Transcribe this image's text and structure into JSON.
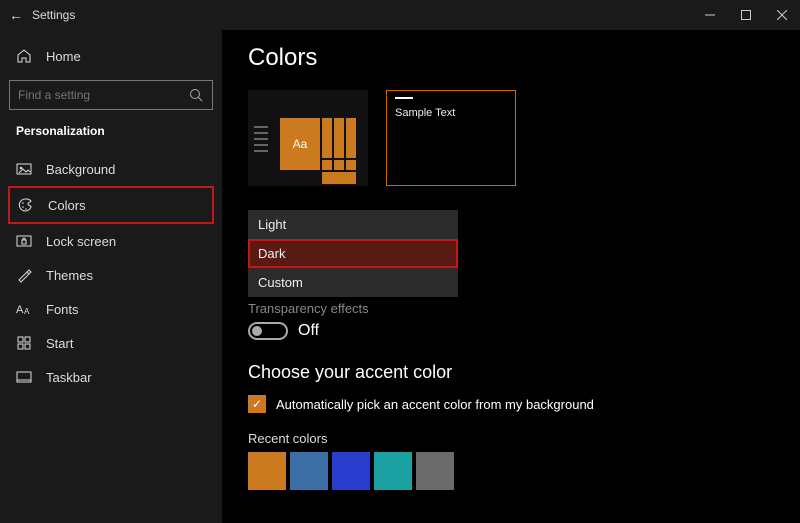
{
  "titlebar": {
    "title": "Settings",
    "back": "←"
  },
  "sidebar": {
    "home": "Home",
    "search_placeholder": "Find a setting",
    "category": "Personalization",
    "items": [
      {
        "label": "Background"
      },
      {
        "label": "Colors"
      },
      {
        "label": "Lock screen"
      },
      {
        "label": "Themes"
      },
      {
        "label": "Fonts"
      },
      {
        "label": "Start"
      },
      {
        "label": "Taskbar"
      }
    ]
  },
  "page": {
    "heading": "Colors",
    "preview_sample_text": "Sample Text",
    "preview_tile": "Aa",
    "mode_options": {
      "light": "Light",
      "dark": "Dark",
      "custom": "Custom"
    },
    "transparency_label": "Transparency effects",
    "transparency_state": "Off",
    "accent_heading": "Choose your accent color",
    "auto_pick_label": "Automatically pick an accent color from my background",
    "recent_label": "Recent colors",
    "recent_colors": [
      "#cc7a1f",
      "#3a6ea5",
      "#2a3ccc",
      "#1aa0a0",
      "#6b6b6b"
    ]
  }
}
